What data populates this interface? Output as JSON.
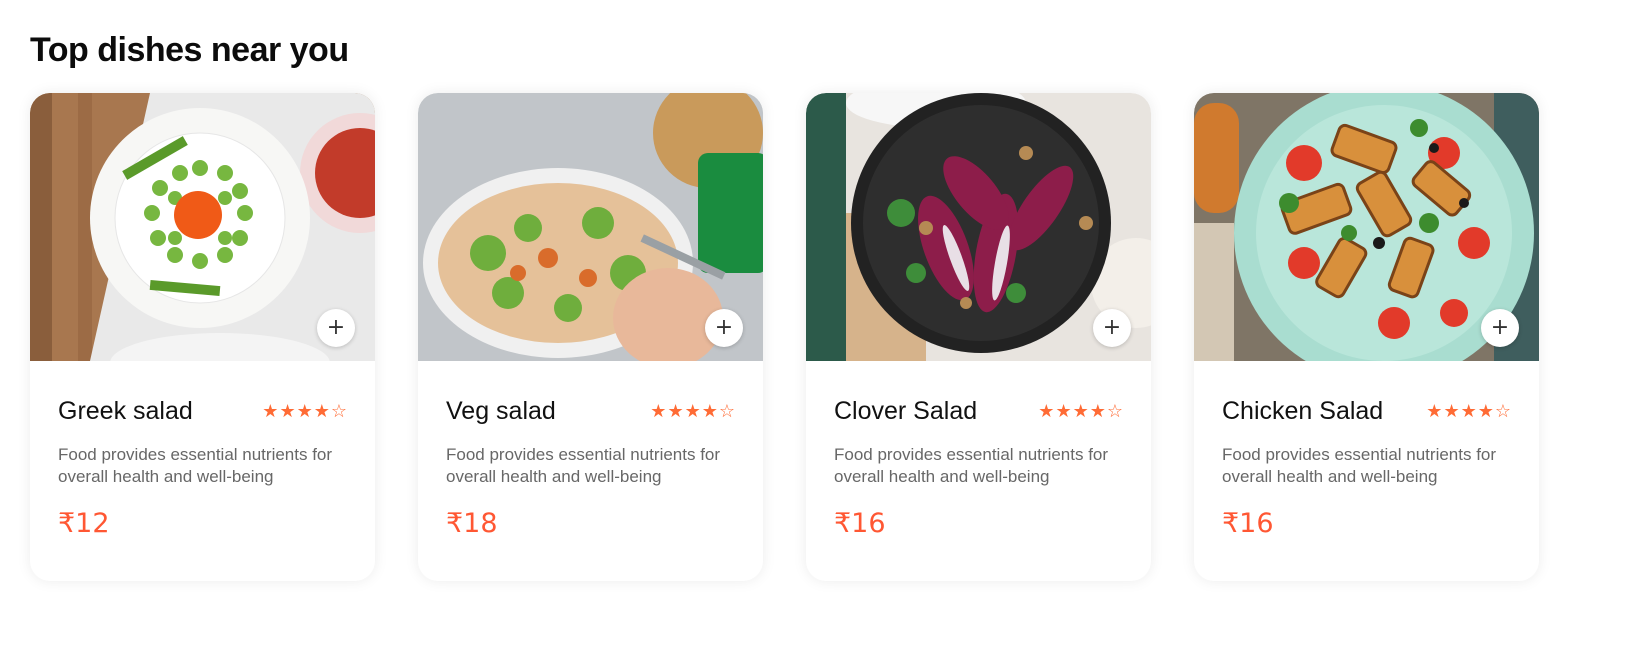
{
  "section": {
    "title": "Top dishes near you"
  },
  "dishes": [
    {
      "name": "Greek salad",
      "description": "Food provides essential nutrients for overall health and well-being",
      "price": "₹12",
      "rating": 4,
      "add_label": "+"
    },
    {
      "name": "Veg salad",
      "description": "Food provides essential nutrients for overall health and well-being",
      "price": "₹18",
      "rating": 4,
      "add_label": "+"
    },
    {
      "name": "Clover Salad",
      "description": "Food provides essential nutrients for overall health and well-being",
      "price": "₹16",
      "rating": 4,
      "add_label": "+"
    },
    {
      "name": "Chicken Salad",
      "description": "Food provides essential nutrients for overall health and well-being",
      "price": "₹16",
      "rating": 4,
      "add_label": "+"
    }
  ],
  "colors": {
    "accent": "#ff5733",
    "star": "#ff6b35",
    "text_muted": "#676767"
  },
  "icons": {
    "add": "plus-icon",
    "star_filled": "star-filled-icon",
    "star_empty": "star-outline-icon"
  }
}
